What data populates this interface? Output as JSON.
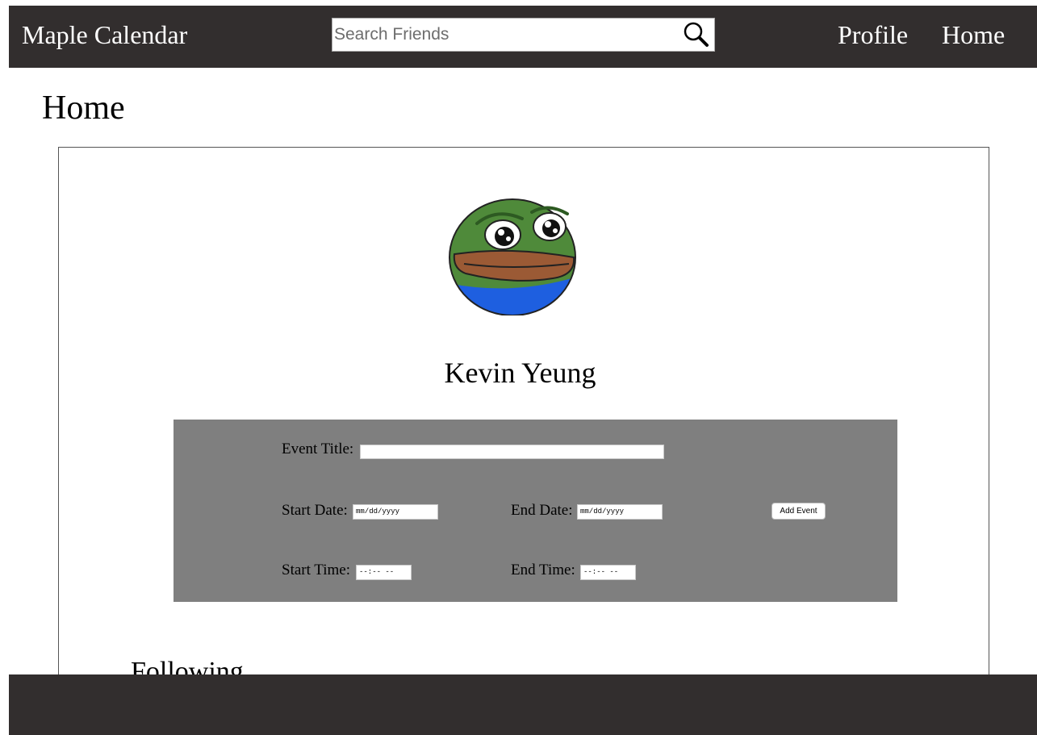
{
  "navbar": {
    "brand": "Maple Calendar",
    "search": {
      "placeholder": "Search Friends",
      "value": ""
    },
    "links": {
      "profile": "Profile",
      "home": "Home"
    }
  },
  "page": {
    "title": "Home"
  },
  "profile": {
    "name": "Kevin Yeung"
  },
  "event_form": {
    "title_label": "Event Title:",
    "title_value": "",
    "start_date_label": "Start Date:",
    "start_date_value": "mm/dd/yyyy",
    "end_date_label": "End Date:",
    "end_date_value": "mm/dd/yyyy",
    "start_time_label": "Start Time:",
    "start_time_value": "--:-- --",
    "end_time_label": "End Time:",
    "end_time_value": "--:-- --",
    "submit_label": "Add Event"
  },
  "following": {
    "heading": "Following"
  },
  "colors": {
    "navbar_bg": "#322e2e",
    "form_bg": "#7f7f7f",
    "avatar_skin": "#4f8a3a",
    "avatar_mouth": "#9b5a35",
    "avatar_shirt": "#1e5fe0"
  },
  "icons": {
    "search": "magnifier-icon",
    "avatar": "frog-avatar-image"
  }
}
